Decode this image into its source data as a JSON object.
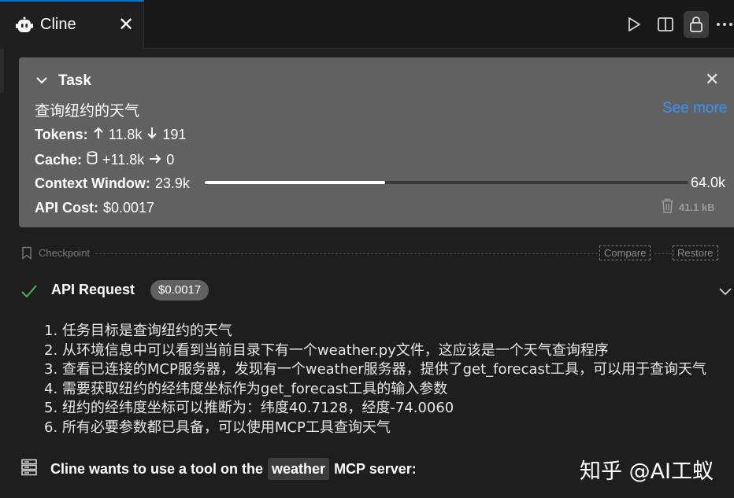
{
  "tab": {
    "title": "Cline",
    "close": "✕"
  },
  "task": {
    "label": "Task",
    "close": "✕",
    "query": "查询纽约的天气",
    "see_more": "See more",
    "tokens": {
      "label": "Tokens:",
      "in": "11.8k",
      "out": "191"
    },
    "cache": {
      "label": "Cache:",
      "write": "+11.8k",
      "read": "0"
    },
    "context": {
      "label": "Context Window:",
      "used": "23.9k",
      "max": "64.0k",
      "fraction": 0.373
    },
    "cost": {
      "label": "API Cost:",
      "value": "$0.0017"
    },
    "size": "41.1 kB"
  },
  "checkpoint": {
    "label": "Checkpoint",
    "compare": "Compare",
    "restore": "Restore"
  },
  "api_request": {
    "label": "API Request",
    "cost": "$0.0017"
  },
  "steps": [
    "1. 任务目标是查询纽约的天气",
    "2. 从环境信息中可以看到当前目录下有一个weather.py文件，这应该是一个天气查询程序",
    "3. 查看已连接的MCP服务器，发现有一个weather服务器，提供了get_forecast工具，可以用于查询天气",
    "4. 需要获取纽约的经纬度坐标作为get_forecast工具的输入参数",
    "5. 纽约的经纬度坐标可以推断为：纬度40.7128，经度-74.0060",
    "6. 所有必要参数都已具备，可以使用MCP工具查询天气"
  ],
  "tool_use": {
    "prefix": "Cline wants to use a tool on the",
    "server": "weather",
    "suffix": "MCP server:"
  },
  "watermark": "知乎 @AI工蚁",
  "colors": {
    "accent": "#0078d4",
    "link": "#3794ff",
    "success": "#3fb950",
    "panel": "#616161"
  }
}
